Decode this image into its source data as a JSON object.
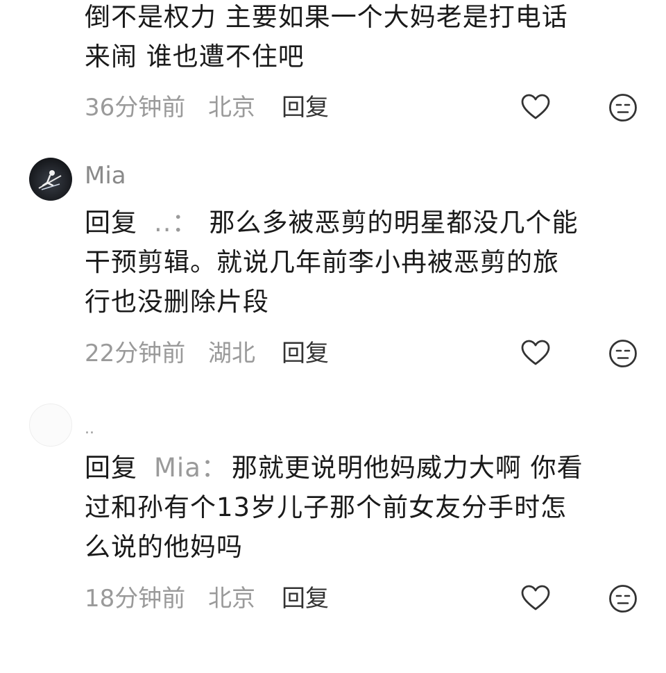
{
  "comments": [
    {
      "username": "",
      "lines": [
        "倒不是权力 主要如果一个大妈老是打电话",
        "来闹 谁也遭不住吧"
      ],
      "reply_prefix": "",
      "reply_target": "",
      "time": "36分钟前",
      "location": "北京",
      "reply_label": "回复"
    },
    {
      "username": "Mia",
      "lines": [
        "那么多被恶剪的明星都没几个能",
        "干预剪辑。就说几年前李小冉被恶剪的旅",
        "行也没删除片段"
      ],
      "reply_prefix": "回复",
      "reply_target": "..：",
      "time": "22分钟前",
      "location": "湖北",
      "reply_label": "回复"
    },
    {
      "username": "..",
      "lines": [
        "那就更说明他妈威力大啊 你看",
        "过和孙有个13岁儿子那个前女友分手时怎",
        "么说的他妈吗"
      ],
      "reply_prefix": "回复",
      "reply_target": "Mia：",
      "time": "18分钟前",
      "location": "北京",
      "reply_label": "回复"
    }
  ],
  "icons": {
    "like": "heart-icon",
    "dislike": "meh-face-icon"
  },
  "colors": {
    "text": "#1a1a1a",
    "muted": "#9a9a9a",
    "icon": "#333333"
  }
}
